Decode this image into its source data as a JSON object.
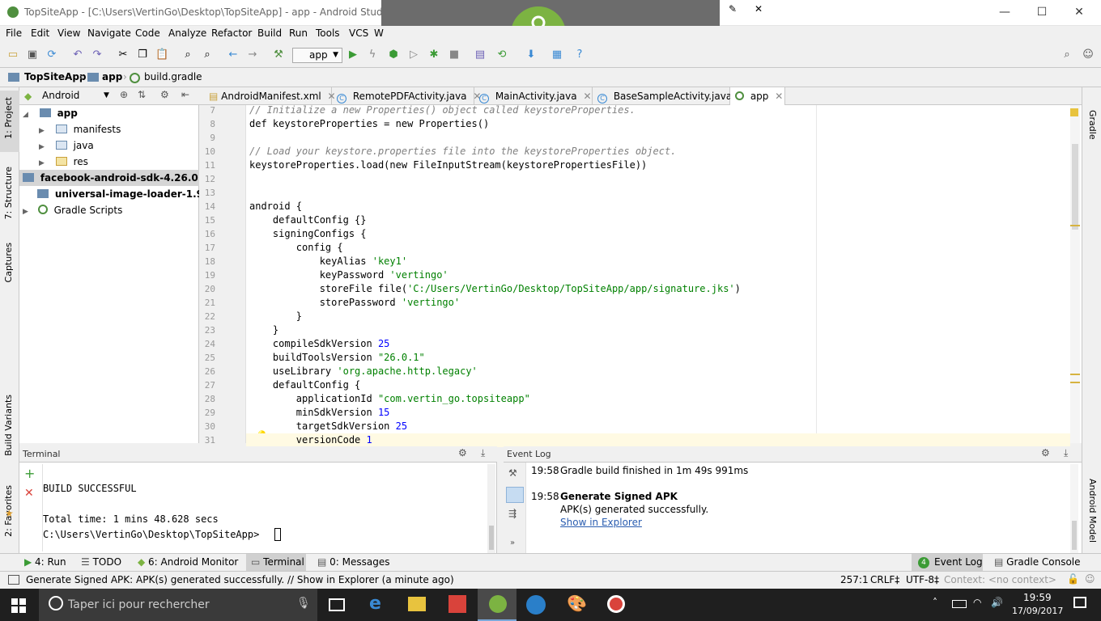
{
  "window": {
    "title": "TopSiteApp - [C:\\Users\\VertinGo\\Desktop\\TopSiteApp] - app - Android Studio 2.3.3"
  },
  "menu": [
    "File",
    "Edit",
    "View",
    "Navigate",
    "Code",
    "Analyze",
    "Refactor",
    "Build",
    "Run",
    "Tools",
    "VCS",
    "W"
  ],
  "toolbar": {
    "run_config": "app"
  },
  "breadcrumb": {
    "project": "TopSiteApp",
    "module": "app",
    "file": "build.gradle"
  },
  "left_tabs": {
    "project": "1: Project",
    "structure": "7: Structure",
    "captures": "Captures",
    "build_variants": "Build Variants",
    "favorites": "2: Favorites"
  },
  "right_tabs": {
    "gradle": "Gradle",
    "android_model": "Android Model"
  },
  "project_panel": {
    "view": "Android",
    "items": [
      {
        "label": "app"
      },
      {
        "label": "manifests"
      },
      {
        "label": "java"
      },
      {
        "label": "res"
      },
      {
        "label": "facebook-android-sdk-4.26.0"
      },
      {
        "label": "universal-image-loader-1.9.5"
      },
      {
        "label": "Gradle Scripts"
      }
    ]
  },
  "editor_tabs": [
    {
      "label": "AndroidManifest.xml"
    },
    {
      "label": "RemotePDFActivity.java"
    },
    {
      "label": "MainActivity.java"
    },
    {
      "label": "BaseSampleActivity.java"
    },
    {
      "label": "app"
    }
  ],
  "code_lines": [
    {
      "n": "7",
      "t": "// Initialize a new Properties() object called keystoreProperties."
    },
    {
      "n": "8",
      "t": "def keystoreProperties = new Properties()"
    },
    {
      "n": "9",
      "t": ""
    },
    {
      "n": "10",
      "t": "// Load your keystore.properties file into the keystoreProperties object."
    },
    {
      "n": "11",
      "t": "keystoreProperties.load(new FileInputStream(keystorePropertiesFile))"
    },
    {
      "n": "12",
      "t": ""
    },
    {
      "n": "13",
      "t": ""
    },
    {
      "n": "14",
      "t": "android {"
    },
    {
      "n": "15",
      "t": "    defaultConfig {}"
    },
    {
      "n": "16",
      "t": "    signingConfigs {"
    },
    {
      "n": "17",
      "t": "        config {"
    },
    {
      "n": "18",
      "t": "            keyAlias 'key1'"
    },
    {
      "n": "19",
      "t": "            keyPassword 'vertingo'"
    },
    {
      "n": "20",
      "t": "            storeFile file('C:/Users/VertinGo/Desktop/TopSiteApp/app/signature.jks')"
    },
    {
      "n": "21",
      "t": "            storePassword 'vertingo'"
    },
    {
      "n": "22",
      "t": "        }"
    },
    {
      "n": "23",
      "t": "    }"
    },
    {
      "n": "24",
      "t": "    compileSdkVersion 25"
    },
    {
      "n": "25",
      "t": "    buildToolsVersion \"26.0.1\""
    },
    {
      "n": "26",
      "t": "    useLibrary 'org.apache.http.legacy'"
    },
    {
      "n": "27",
      "t": "    defaultConfig {"
    },
    {
      "n": "28",
      "t": "        applicationId \"com.vertin_go.topsiteapp\""
    },
    {
      "n": "29",
      "t": "        minSdkVersion 15"
    },
    {
      "n": "30",
      "t": "        targetSdkVersion 25"
    },
    {
      "n": "31",
      "t": "        versionCode 1"
    }
  ],
  "terminal": {
    "title": "Terminal",
    "lines": [
      "BUILD SUCCESSFUL",
      "",
      "Total time: 1 mins 48.628 secs",
      "C:\\Users\\VertinGo\\Desktop\\TopSiteApp>"
    ]
  },
  "event_log": {
    "title": "Event Log",
    "entries": [
      {
        "time": "19:58",
        "text": "Gradle build finished in 1m 49s 991ms"
      },
      {
        "time": "19:58",
        "title": "Generate Signed APK",
        "text": "APK(s) generated successfully.",
        "link": "Show in Explorer"
      }
    ]
  },
  "bottom_tabs": {
    "run": "4: Run",
    "todo": "TODO",
    "monitor": "6: Android Monitor",
    "terminal": "Terminal",
    "messages": "0: Messages",
    "event_log": "Event Log",
    "event_count": "4",
    "gradle_console": "Gradle Console"
  },
  "status": {
    "message": "Generate Signed APK: APK(s) generated successfully. // Show in Explorer (a minute ago)",
    "position": "257:1",
    "line_sep": "CRLF‡",
    "encoding": "UTF-8‡",
    "context": "Context: <no context>"
  },
  "taskbar": {
    "search_placeholder": "Taper ici pour rechercher",
    "time": "19:59",
    "date": "17/09/2017"
  },
  "colors": {
    "android_green": "#7cb342",
    "accent_blue": "#3a8ad4",
    "taskbar": "#1f1f1f"
  }
}
